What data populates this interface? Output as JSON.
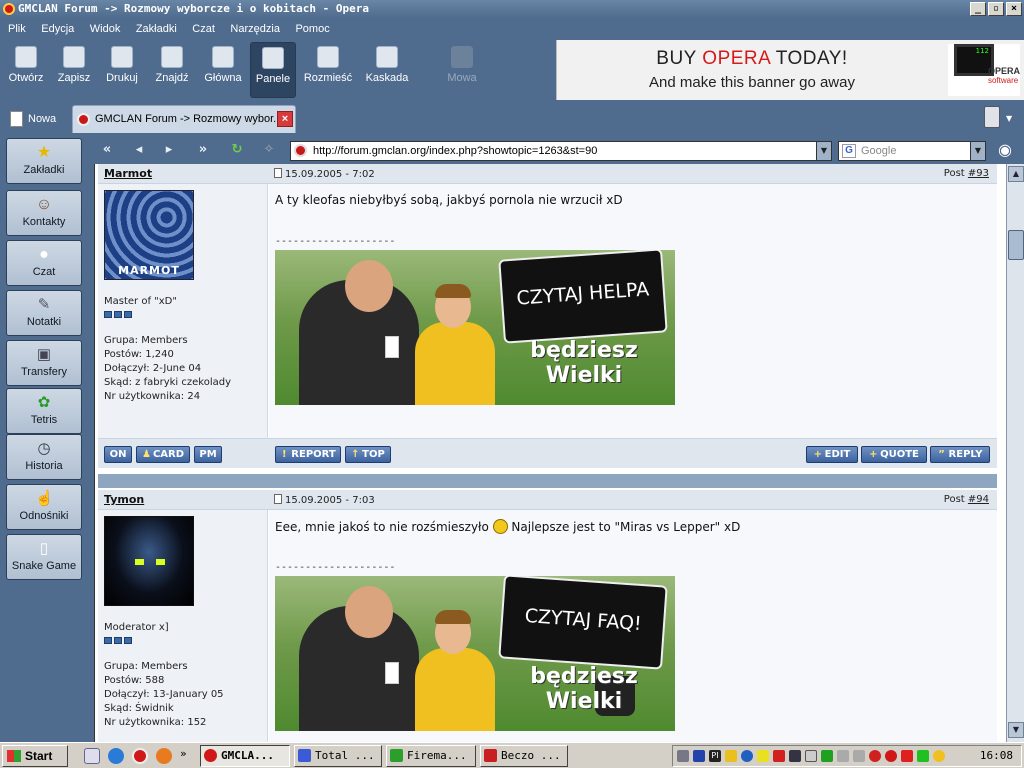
{
  "window": {
    "title": "GMCLAN Forum -> Rozmowy wyborcze i o kobitach - Opera"
  },
  "menu": [
    "Plik",
    "Edycja",
    "Widok",
    "Zakładki",
    "Czat",
    "Narzędzia",
    "Pomoc"
  ],
  "toolbar": [
    "Otwórz",
    "Zapisz",
    "Drukuj",
    "Znajdź",
    "Główna",
    "Panele",
    "Rozmieść",
    "Kaskada",
    "Mowa"
  ],
  "banner": {
    "line1_a": "BUY ",
    "line1_b": "OPERA",
    "line1_c": " TODAY!",
    "line2": "And make this banner go away",
    "logo": "OPERA",
    "logo_sub": "software",
    "monitor": "112"
  },
  "tabs": {
    "new_label": "Nowa",
    "active": "GMCLAN Forum -> Rozmowy wybor..."
  },
  "address": {
    "url": "http://forum.gmclan.org/index.php?showtopic=1263&st=90",
    "search_placeholder": "Google"
  },
  "panels": [
    "Zakładki",
    "Kontakty",
    "Czat",
    "Notatki",
    "Transfery",
    "Tetris",
    "Historia",
    "Odnośniki",
    "Snake Game"
  ],
  "posts": [
    {
      "user": "Marmot",
      "date": "15.09.2005 - 7:02",
      "post_label": "Post ",
      "post_num": "#93",
      "avatar_text": "MARMOT",
      "rank": "Master of \"xD\"",
      "group": "Grupa: Members",
      "posts": "Postów: 1,240",
      "joined": "Dołączył: 2-June 04",
      "from": "Skąd: z fabryki czekolady",
      "uid": "Nr użytkownika: 24",
      "text": "A ty kleofas niebyłbyś sobą, jakbyś pornola nie wrzucił xD",
      "separator": "--------------------",
      "sig_sign": "CZYTAJ HELPA",
      "sig_bottom": "będziesz Wielki"
    },
    {
      "user": "Tymon",
      "date": "15.09.2005 - 7:03",
      "post_label": "Post ",
      "post_num": "#94",
      "rank": "Moderator x]",
      "group": "Grupa: Members",
      "posts": "Postów: 588",
      "joined": "Dołączył: 13-January 05",
      "from": "Skąd: Świdnik",
      "uid": "Nr użytkownika: 152",
      "text_a": "Eee, mnie jakoś to nie rozśmieszyło ",
      "text_b": " Najlepsze jest to \"Miras vs Lepper\" xD",
      "separator": "--------------------",
      "sig_sign": "CZYTAJ FAQ!",
      "sig_bottom": "będziesz Wielki"
    }
  ],
  "post_buttons": {
    "on": "ON",
    "card": "CARD",
    "pm": "PM",
    "report": "REPORT",
    "top": "TOP",
    "edit": "EDIT",
    "quote": "QUOTE",
    "reply": "REPLY"
  },
  "taskbar": {
    "start": "Start",
    "tasks": [
      "GMCLA...",
      "Total ...",
      "Firema...",
      "Beczo ..."
    ],
    "clock": "16:08",
    "tray_text": "PI"
  }
}
